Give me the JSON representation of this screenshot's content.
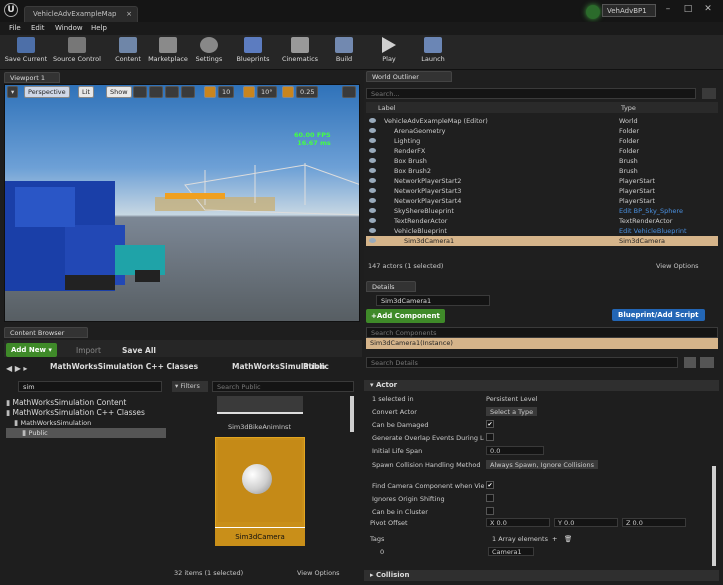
{
  "title": {
    "doc_tab": "VehicleAdvExampleMap",
    "project": "VehAdvBP1"
  },
  "menu": [
    "File",
    "Edit",
    "Window",
    "Help"
  ],
  "toolbar": [
    {
      "label": "Save Current",
      "icon": "save-icon"
    },
    {
      "label": "Source Control",
      "icon": "source-control-icon"
    },
    {
      "label": "Content",
      "icon": "content-icon"
    },
    {
      "label": "Marketplace",
      "icon": "marketplace-icon"
    },
    {
      "label": "Settings",
      "icon": "settings-icon"
    },
    {
      "label": "Blueprints",
      "icon": "blueprints-icon"
    },
    {
      "label": "Cinematics",
      "icon": "cinematics-icon"
    },
    {
      "label": "Build",
      "icon": "build-icon"
    },
    {
      "label": "Play",
      "icon": "play-icon"
    },
    {
      "label": "Launch",
      "icon": "launch-icon"
    }
  ],
  "viewport": {
    "tab": "Viewport 1",
    "perspective": "Perspective",
    "lit": "Lit",
    "show": "Show",
    "grid": "10",
    "angle": "10°",
    "scale": "0.25",
    "fps": "60.00 FPS",
    "ms": "16.67 ms"
  },
  "outliner": {
    "tab": "World Outliner",
    "search_placeholder": "Search...",
    "col_label": "Label",
    "col_type": "Type",
    "rows": [
      {
        "label": "VehicleAdvExampleMap (Editor)",
        "type": "World",
        "indent": 0
      },
      {
        "label": "ArenaGeometry",
        "type": "Folder",
        "indent": 1
      },
      {
        "label": "Lighting",
        "type": "Folder",
        "indent": 1
      },
      {
        "label": "RenderFX",
        "type": "Folder",
        "indent": 1
      },
      {
        "label": "Box Brush",
        "type": "Brush",
        "indent": 1
      },
      {
        "label": "Box Brush2",
        "type": "Brush",
        "indent": 1
      },
      {
        "label": "NetworkPlayerStart2",
        "type": "PlayerStart",
        "indent": 1
      },
      {
        "label": "NetworkPlayerStart3",
        "type": "PlayerStart",
        "indent": 1
      },
      {
        "label": "NetworkPlayerStart4",
        "type": "PlayerStart",
        "indent": 1
      },
      {
        "label": "SkyShereBlueprint",
        "type": "Edit BP_Sky_Sphere",
        "indent": 1,
        "link": true
      },
      {
        "label": "TextRenderActor",
        "type": "TextRenderActor",
        "indent": 1
      },
      {
        "label": "VehicleBlueprint",
        "type": "Edit VehicleBlueprint",
        "indent": 1,
        "link": true
      },
      {
        "label": "Sim3dCamera1",
        "type": "Sim3dCamera",
        "indent": 2,
        "selected": true
      }
    ],
    "footer": "147 actors (1 selected)",
    "view_options": "View Options"
  },
  "details": {
    "tab": "Details",
    "name_value": "Sim3dCamera1",
    "add_component": "+Add Component",
    "blueprint_script": "Blueprint/Add Script",
    "search_components": "Search Components",
    "instance_row": "Sim3dCamera1(Instance)",
    "search_details": "Search Details",
    "section_actor": "Actor",
    "section_collision": "Collision",
    "props": [
      {
        "label": "1 selected in",
        "value": "Persistent Level",
        "kind": "text"
      },
      {
        "label": "Convert Actor",
        "value": "Select a Type",
        "kind": "dropdown"
      },
      {
        "label": "Can be Damaged",
        "value": "✔",
        "kind": "check"
      },
      {
        "label": "Generate Overlap Events During Level S",
        "value": "",
        "kind": "check"
      },
      {
        "label": "Initial Life Span",
        "value": "0.0",
        "kind": "input"
      },
      {
        "label": "Spawn Collision Handling Method",
        "value": "Always Spawn, Ignore Collisions",
        "kind": "dropdown"
      },
      {
        "label": "Find Camera Component when View Ta",
        "value": "✔",
        "kind": "check"
      },
      {
        "label": "Ignores Origin Shifting",
        "value": "",
        "kind": "check"
      },
      {
        "label": "Can be in Cluster",
        "value": "",
        "kind": "check"
      }
    ],
    "pivot": {
      "label": "Pivot Offset",
      "x": "X  0.0",
      "y": "Y  0.0",
      "z": "Z  0.0"
    },
    "tags": {
      "label": "Tags",
      "count": "1 Array elements",
      "index": "0",
      "value": "Camera1"
    }
  },
  "content_browser": {
    "tab": "Content Browser",
    "add_new": "Add New",
    "import": "Import",
    "save_all": "Save All",
    "path": [
      "MathWorksSimulation C++ Classes",
      "MathWorksSimulation",
      "Public"
    ],
    "search_value": "sim",
    "filters": "Filters",
    "search_public": "Search Public",
    "tree": [
      {
        "label": "MathWorksSimulation Content",
        "indent": 0
      },
      {
        "label": "MathWorksSimulation C++ Classes",
        "indent": 0
      },
      {
        "label": "MathWorksSimulation",
        "indent": 1
      },
      {
        "label": "Public",
        "indent": 2,
        "selected": true
      }
    ],
    "asset_above": "Sim3dBikeAnimInst",
    "asset_selected": "Sim3dCamera",
    "footer": "32 items (1 selected)",
    "view_options": "View Options"
  }
}
